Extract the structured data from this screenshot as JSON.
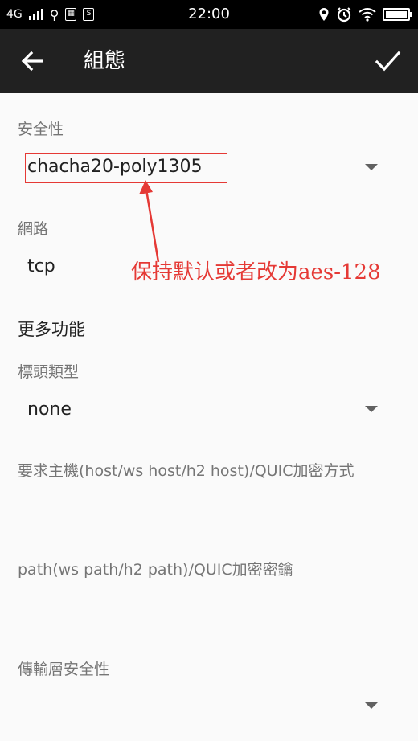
{
  "status_bar": {
    "network": "4G",
    "time": "22:00",
    "icons": [
      "signal-icon",
      "usb-icon",
      "sim-icon",
      "sync-icon",
      "location-icon",
      "alarm-icon",
      "wifi-icon",
      "battery-icon"
    ]
  },
  "toolbar": {
    "title": "組態",
    "back_icon": "arrow-left-icon",
    "confirm_icon": "checkmark-icon"
  },
  "form": {
    "security": {
      "label": "安全性",
      "value": "chacha20-poly1305"
    },
    "network": {
      "label": "網路",
      "value": "tcp"
    },
    "more_features": "更多功能",
    "header_type": {
      "label": "標頭類型",
      "value": "none"
    },
    "host": {
      "label": "要求主機(host/ws host/h2 host)/QUIC加密方式",
      "value": ""
    },
    "path": {
      "label": "path(ws path/h2 path)/QUIC加密密鑰",
      "value": ""
    },
    "tls": {
      "label": "傳輸層安全性",
      "value": ""
    }
  },
  "annotation": {
    "text": "保持默认或者改为aes-128",
    "color": "#e53935"
  },
  "colors": {
    "toolbar_bg": "#212121",
    "status_bg": "#000000",
    "page_bg": "#fafafa",
    "annotation_red": "#e53935"
  }
}
